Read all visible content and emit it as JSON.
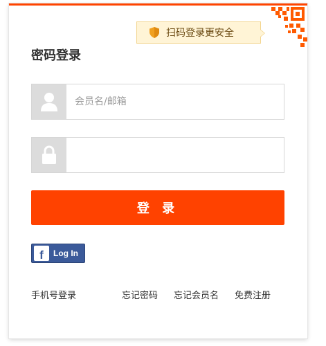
{
  "header": {
    "title": "密码登录",
    "qr_tip": "扫码登录更安全"
  },
  "form": {
    "username_placeholder": "会员名/邮箱",
    "username_value": "",
    "password_value": "",
    "submit_label": "登 录"
  },
  "social": {
    "facebook_label": "Log In"
  },
  "footer_links": {
    "phone_login": "手机号登录",
    "forgot_password": "忘记密码",
    "forgot_username": "忘记会员名",
    "register": "免费注册"
  },
  "colors": {
    "accent": "#ff4200",
    "facebook": "#3b5a9a",
    "tip_bg": "#fff4d6",
    "shield": "#f0a020"
  },
  "icons": {
    "tip": "shield-icon",
    "qr": "qr-code-icon",
    "username": "user-icon",
    "password": "lock-icon",
    "facebook": "facebook-icon"
  }
}
